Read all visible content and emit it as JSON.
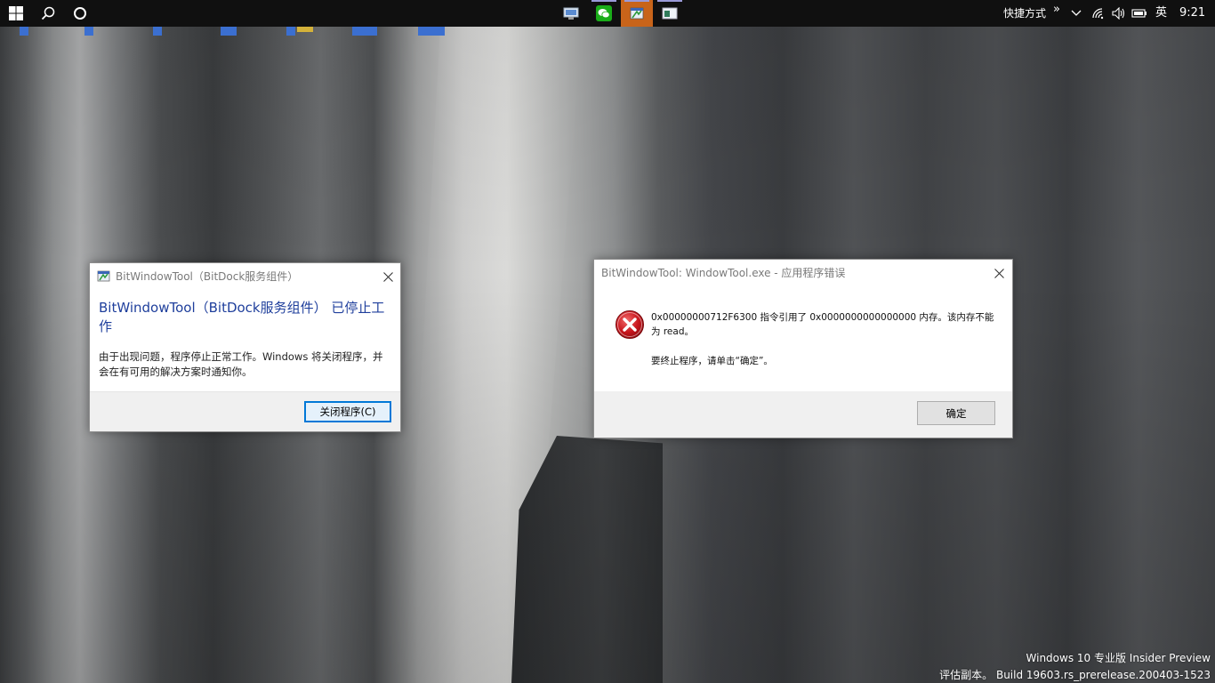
{
  "taskbar": {
    "tray": {
      "quick_launch_label": "快捷方式",
      "overflow_glyph": "»",
      "ime_label": "英",
      "clock": "9:21"
    }
  },
  "dialog_crash": {
    "title": "BitWindowTool（BitDock服务组件）",
    "heading": "BitWindowTool（BitDock服务组件） 已停止工作",
    "body": "由于出现问题，程序停止正常工作。Windows 将关闭程序，并会在有可用的解决方案时通知你。",
    "close_program_button": "关闭程序(C)"
  },
  "dialog_error": {
    "title": "BitWindowTool: WindowTool.exe - 应用程序错误",
    "message": "0x00000000712F6300 指令引用了 0x0000000000000000 内存。该内存不能为 read。",
    "instruction": "要终止程序，请单击“确定”。",
    "ok_button": "确定"
  },
  "watermark": {
    "line1": "Windows 10 专业版 Insider Preview",
    "line2": "评估副本。 Build 19603.rs_prerelease.200403-1523"
  }
}
